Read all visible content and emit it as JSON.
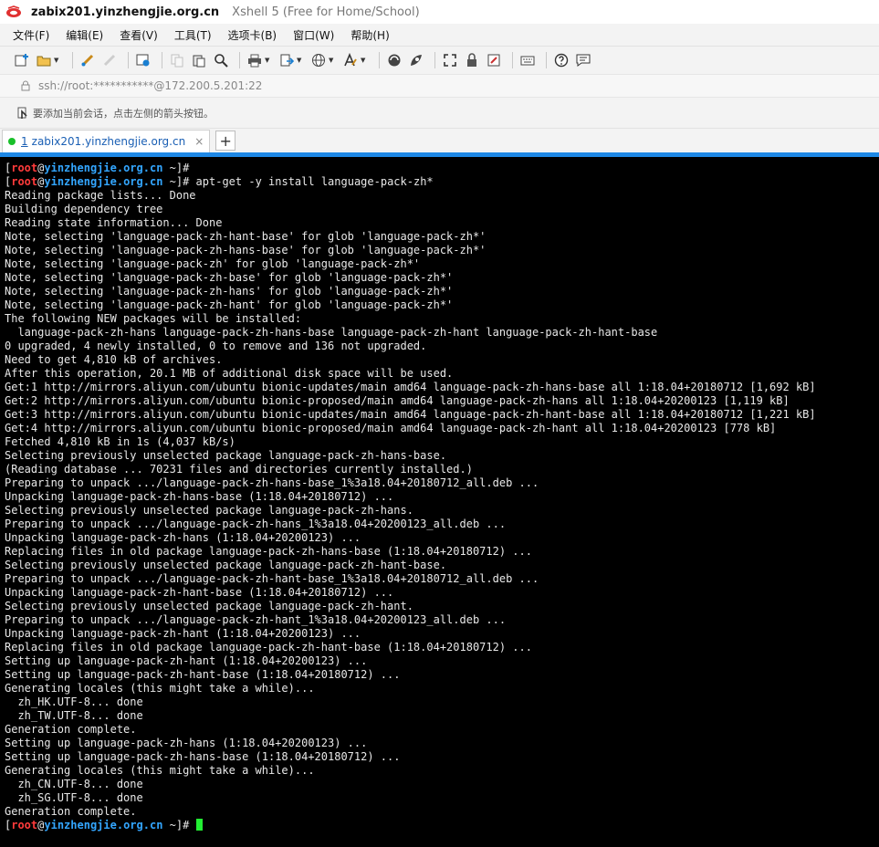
{
  "window": {
    "title_main": "zabix201.yinzhengjie.org.cn",
    "title_sub": "Xshell 5 (Free for Home/School)"
  },
  "menu": {
    "items": [
      "文件(F)",
      "编辑(E)",
      "查看(V)",
      "工具(T)",
      "选项卡(B)",
      "窗口(W)",
      "帮助(H)"
    ]
  },
  "address": {
    "text": "ssh://root:***********@172.200.5.201:22"
  },
  "hint": {
    "text": "要添加当前会话，点击左侧的箭头按钮。"
  },
  "tabs": [
    {
      "number": "1",
      "label": "zabix201.yinzhengjie.org.cn",
      "close": "×"
    }
  ],
  "tab_add_label": "+",
  "colors": {
    "prompt_user": "#ff3b3b",
    "prompt_host": "#33a6ff",
    "cursor": "#22ee33",
    "tab_accent": "#1e88e5",
    "connected": "#19c02a"
  },
  "terminal": {
    "prompt": {
      "open": "[",
      "user": "root",
      "at": "@",
      "host": "yinzhengjie.org.cn",
      "path": " ~]#"
    },
    "lines": [
      {
        "prompt": true,
        "text": ""
      },
      {
        "prompt": true,
        "text": " apt-get -y install language-pack-zh*"
      },
      {
        "text": "Reading package lists... Done"
      },
      {
        "text": "Building dependency tree"
      },
      {
        "text": "Reading state information... Done"
      },
      {
        "text": "Note, selecting 'language-pack-zh-hant-base' for glob 'language-pack-zh*'"
      },
      {
        "text": "Note, selecting 'language-pack-zh-hans-base' for glob 'language-pack-zh*'"
      },
      {
        "text": "Note, selecting 'language-pack-zh' for glob 'language-pack-zh*'"
      },
      {
        "text": "Note, selecting 'language-pack-zh-base' for glob 'language-pack-zh*'"
      },
      {
        "text": "Note, selecting 'language-pack-zh-hans' for glob 'language-pack-zh*'"
      },
      {
        "text": "Note, selecting 'language-pack-zh-hant' for glob 'language-pack-zh*'"
      },
      {
        "text": "The following NEW packages will be installed:"
      },
      {
        "text": "  language-pack-zh-hans language-pack-zh-hans-base language-pack-zh-hant language-pack-zh-hant-base"
      },
      {
        "text": "0 upgraded, 4 newly installed, 0 to remove and 136 not upgraded."
      },
      {
        "text": "Need to get 4,810 kB of archives."
      },
      {
        "text": "After this operation, 20.1 MB of additional disk space will be used."
      },
      {
        "text": "Get:1 http://mirrors.aliyun.com/ubuntu bionic-updates/main amd64 language-pack-zh-hans-base all 1:18.04+20180712 [1,692 kB]"
      },
      {
        "text": "Get:2 http://mirrors.aliyun.com/ubuntu bionic-proposed/main amd64 language-pack-zh-hans all 1:18.04+20200123 [1,119 kB]"
      },
      {
        "text": "Get:3 http://mirrors.aliyun.com/ubuntu bionic-updates/main amd64 language-pack-zh-hant-base all 1:18.04+20180712 [1,221 kB]"
      },
      {
        "text": "Get:4 http://mirrors.aliyun.com/ubuntu bionic-proposed/main amd64 language-pack-zh-hant all 1:18.04+20200123 [778 kB]"
      },
      {
        "text": "Fetched 4,810 kB in 1s (4,037 kB/s)"
      },
      {
        "text": "Selecting previously unselected package language-pack-zh-hans-base."
      },
      {
        "text": "(Reading database ... 70231 files and directories currently installed.)"
      },
      {
        "text": "Preparing to unpack .../language-pack-zh-hans-base_1%3a18.04+20180712_all.deb ..."
      },
      {
        "text": "Unpacking language-pack-zh-hans-base (1:18.04+20180712) ..."
      },
      {
        "text": "Selecting previously unselected package language-pack-zh-hans."
      },
      {
        "text": "Preparing to unpack .../language-pack-zh-hans_1%3a18.04+20200123_all.deb ..."
      },
      {
        "text": "Unpacking language-pack-zh-hans (1:18.04+20200123) ..."
      },
      {
        "text": "Replacing files in old package language-pack-zh-hans-base (1:18.04+20180712) ..."
      },
      {
        "text": "Selecting previously unselected package language-pack-zh-hant-base."
      },
      {
        "text": "Preparing to unpack .../language-pack-zh-hant-base_1%3a18.04+20180712_all.deb ..."
      },
      {
        "text": "Unpacking language-pack-zh-hant-base (1:18.04+20180712) ..."
      },
      {
        "text": "Selecting previously unselected package language-pack-zh-hant."
      },
      {
        "text": "Preparing to unpack .../language-pack-zh-hant_1%3a18.04+20200123_all.deb ..."
      },
      {
        "text": "Unpacking language-pack-zh-hant (1:18.04+20200123) ..."
      },
      {
        "text": "Replacing files in old package language-pack-zh-hant-base (1:18.04+20180712) ..."
      },
      {
        "text": "Setting up language-pack-zh-hant (1:18.04+20200123) ..."
      },
      {
        "text": "Setting up language-pack-zh-hant-base (1:18.04+20180712) ..."
      },
      {
        "text": "Generating locales (this might take a while)..."
      },
      {
        "text": "  zh_HK.UTF-8... done"
      },
      {
        "text": "  zh_TW.UTF-8... done"
      },
      {
        "text": "Generation complete."
      },
      {
        "text": "Setting up language-pack-zh-hans (1:18.04+20200123) ..."
      },
      {
        "text": "Setting up language-pack-zh-hans-base (1:18.04+20180712) ..."
      },
      {
        "text": "Generating locales (this might take a while)..."
      },
      {
        "text": "  zh_CN.UTF-8... done"
      },
      {
        "text": "  zh_SG.UTF-8... done"
      },
      {
        "text": "Generation complete."
      },
      {
        "prompt": true,
        "text": " ",
        "cursor": true
      }
    ]
  }
}
